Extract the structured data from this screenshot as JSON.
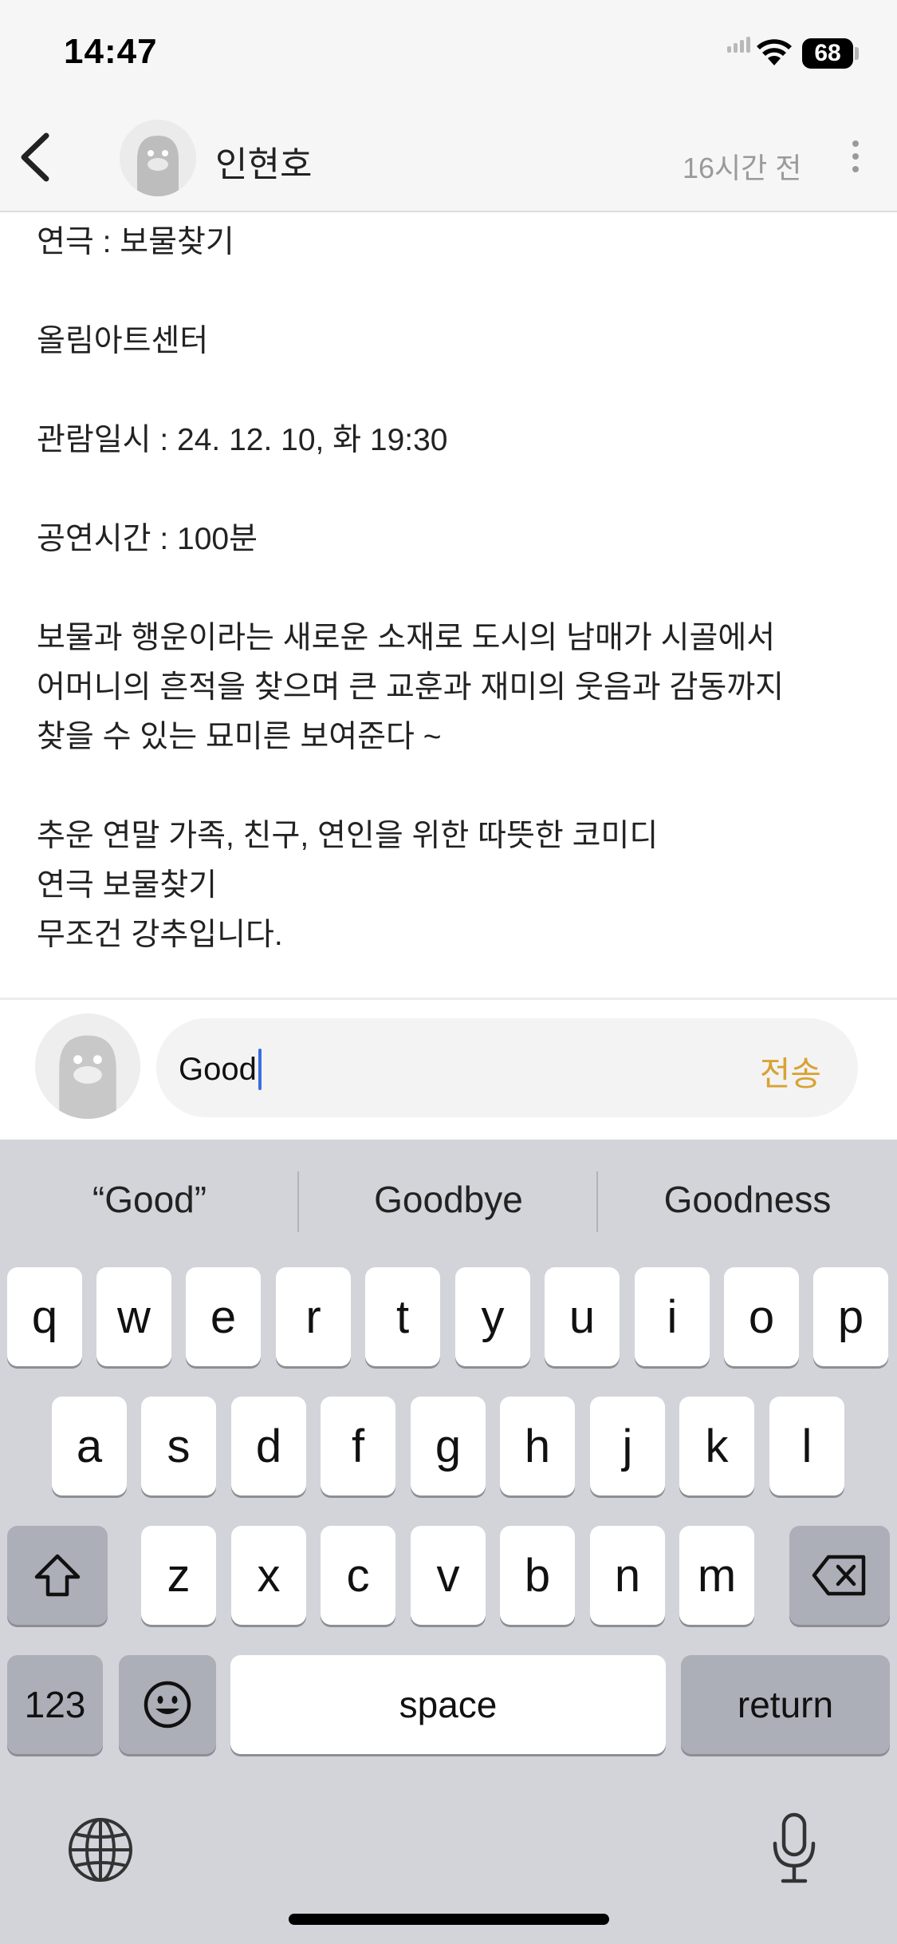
{
  "status_bar": {
    "time": "14:47",
    "battery": "68"
  },
  "header": {
    "author": "인현호",
    "time_ago": "16시간 전"
  },
  "post": {
    "lines": [
      "연극 : 보물찾기",
      "올림아트센터",
      "관람일시 : 24. 12. 10, 화 19:30",
      "공연시간 : 100분",
      "보물과 행운이라는 새로운 소재로 도시의 남매가 시골에서",
      "어머니의 흔적을 찾으며 큰 교훈과 재미의 웃음과 감동까지",
      "찾을 수 있는 묘미른 보여준다 ~",
      "추운 연말 가족, 친구, 연인을 위한 따뜻한 코미디",
      "연극 보물찾기",
      "무조건 강추입니다."
    ]
  },
  "comment": {
    "value": "Good",
    "send_label": "전송"
  },
  "keyboard": {
    "suggestions": [
      "“Good”",
      "Goodbye",
      "Goodness"
    ],
    "row1": [
      "q",
      "w",
      "e",
      "r",
      "t",
      "y",
      "u",
      "i",
      "o",
      "p"
    ],
    "row2": [
      "a",
      "s",
      "d",
      "f",
      "g",
      "h",
      "j",
      "k",
      "l"
    ],
    "row3": [
      "z",
      "x",
      "c",
      "v",
      "b",
      "n",
      "m"
    ],
    "numbers_label": "123",
    "space_label": "space",
    "return_label": "return"
  },
  "colors": {
    "accent": "#d9a233",
    "caret": "#3b6fe0",
    "keyboard_bg": "#d2d4da"
  },
  "icons": [
    "back-arrow",
    "more-vertical",
    "wifi",
    "shift",
    "backspace",
    "emoji",
    "globe",
    "microphone"
  ]
}
